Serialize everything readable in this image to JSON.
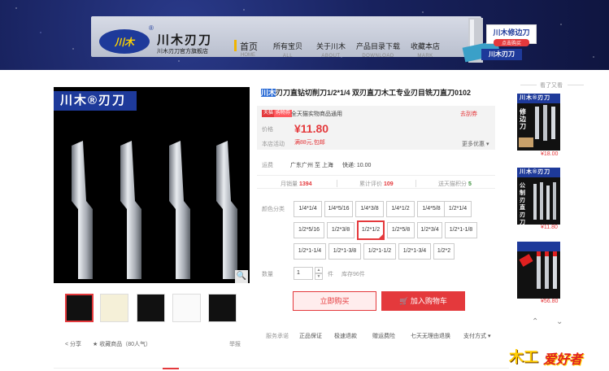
{
  "header": {
    "logo_text": "川木",
    "logo_registered": "®",
    "brand_name": "川木刃刀",
    "brand_sub": "川木刃刀官方旗舰店",
    "nav": [
      {
        "cn": "首页",
        "en": "HOME"
      },
      {
        "cn": "所有宝贝",
        "en": "ALL"
      },
      {
        "cn": "关于川木",
        "en": "ABOUT"
      },
      {
        "cn": "产品目录下载",
        "en": "DOWNLOAD"
      },
      {
        "cn": "收藏本店",
        "en": "MARK"
      }
    ],
    "promo_title": "川木修边刀",
    "promo_sub": "点击购买",
    "promo_logo": "川木刃刀"
  },
  "gallery": {
    "brand_bar": "川木®刃刀",
    "zoom_icon": "magnifier-icon",
    "thumbnails": 6,
    "share": "分享",
    "favorite": "收藏商品（80人气）",
    "report": "举报"
  },
  "product": {
    "title_highlight": "川木",
    "title_rest": "刃刀直钻切削刀1/2*1/4 双刃直刀木工专业刃目铣刀直刀0102",
    "tag_tmall": "天猫",
    "tag_buy": "购物券",
    "tag_text": "全天猫实物商品通用",
    "tag_link": "去刮券",
    "price_label": "价格",
    "price": "¥11.80",
    "promo_label": "本店活动",
    "promo_text": "满88元,包邮",
    "promo_more": "更多优惠",
    "shipping_label": "运费",
    "shipping_text": "广东广州 至 上海",
    "shipping_fee": "快递: 10.00",
    "monthly_sales_label": "月销量",
    "monthly_sales": "1394",
    "reviews_label": "累计评价",
    "reviews": "109",
    "points_label": "送天猫积分",
    "points": "5",
    "color_label": "颜色分类",
    "options": [
      "1/4*1/4",
      "1/4*5/16",
      "1/4*3/8",
      "1/4*1/2",
      "1/4*5/8",
      "1/2*1/4",
      "1/2*5/16",
      "1/2*3/8",
      "1/2*1/2",
      "1/2*5/8",
      "1/2*3/4",
      "1/2*1-1/8",
      "1/2*1-1/4",
      "1/2*1-3/8",
      "1/2*1-1/2",
      "1/2*1-3/4",
      "1/2*2"
    ],
    "selected_option": "1/2*1/2",
    "qty_label": "数量",
    "qty": "1",
    "qty_unit": "件",
    "stock": "库存96件",
    "buy_now": "立即购买",
    "add_cart": "加入购物车",
    "service_label": "服务承诺",
    "services": [
      "正品保证",
      "极速退款",
      "赠运费险",
      "七天无理由退换"
    ],
    "payment": "支付方式"
  },
  "sidebar": {
    "heading": "看了又看",
    "items": [
      {
        "brand": "川木®刃刀",
        "caption": "修边刀",
        "price": "¥18.00"
      },
      {
        "brand": "川木®刃刀",
        "caption": "公制刃直刃刀",
        "price": "¥11.80"
      },
      {
        "brand": "",
        "caption": "",
        "price": "¥56.80"
      }
    ]
  },
  "watermark": {
    "left": "木工",
    "right": "爱好者"
  },
  "colors": {
    "accent": "#e4393c",
    "brand_blue": "#1e3a9a"
  }
}
